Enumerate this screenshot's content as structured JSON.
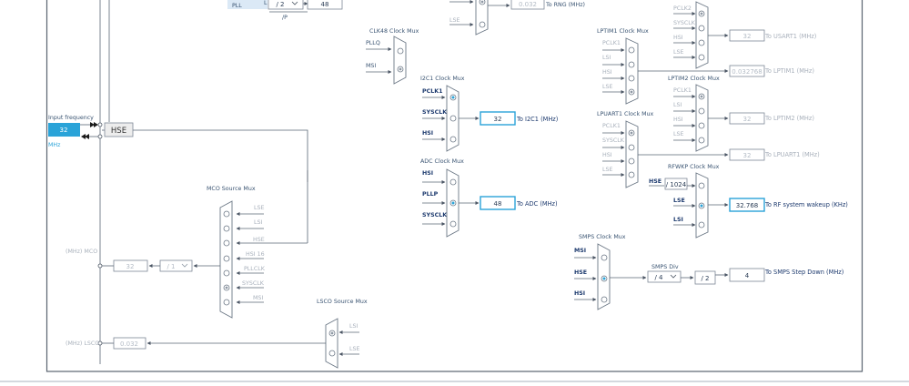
{
  "hse": {
    "label": "HSE",
    "input_label": "Input frequency",
    "input_value": "32",
    "input_unit": "MHz"
  },
  "pll": {
    "label": "PLL",
    "div_value": "/ 2",
    "out_value": "48",
    "p_label": "/P"
  },
  "rng": {
    "value": "0.032",
    "label": "To RNG (MHz)"
  },
  "clk48": {
    "title": "CLK48 Clock Mux",
    "inputs": [
      "PLLQ",
      "MSI"
    ]
  },
  "i2c1": {
    "title": "I2C1 Clock Mux",
    "inputs": [
      "PCLK1",
      "SYSCLK",
      "HSI"
    ],
    "value": "32",
    "label": "To I2C1 (MHz)"
  },
  "adc": {
    "title": "ADC Clock Mux",
    "inputs": [
      "HSI",
      "PLLP",
      "SYSCLK"
    ],
    "value": "48",
    "label": "To ADC (MHz)"
  },
  "usart1": {
    "inputs": [
      "PCLK2",
      "SYSCLK",
      "HSI",
      "LSE"
    ],
    "value": "32",
    "label": "To USART1 (MHz)"
  },
  "lptim1": {
    "title": "LPTIM1 Clock Mux",
    "inputs": [
      "PCLK1",
      "LSI",
      "HSI",
      "LSE"
    ],
    "value": "0.032768",
    "label": "To LPTIM1 (MHz)"
  },
  "lptim2": {
    "title": "LPTIM2 Clock Mux",
    "inputs": [
      "PCLK1",
      "LSI",
      "HSI",
      "LSE"
    ],
    "value": "32",
    "label": "To LPTIM2 (MHz)"
  },
  "lpuart1": {
    "title": "LPUART1 Clock Mux",
    "inputs": [
      "PCLK1",
      "SYSCLK",
      "HSI",
      "LSE"
    ],
    "value": "32",
    "label": "To LPUART1 (MHz)"
  },
  "rfwkp": {
    "title": "RFWKP Clock Mux",
    "hse_label": "HSE",
    "div_value": "/ 1024",
    "inputs": [
      "LSE",
      "LSI"
    ],
    "value": "32.768",
    "label": "To RF system wakeup (KHz)"
  },
  "smps": {
    "title": "SMPS Clock Mux",
    "inputs": [
      "MSI",
      "HSE",
      "HSI"
    ],
    "div_title": "SMPS Div",
    "div_value": "/ 4",
    "div2_value": "/ 2",
    "value": "4",
    "label": "To SMPS Step Down (MHz)"
  },
  "mco": {
    "title": "MCO Source Mux",
    "inputs": [
      "LSE",
      "LSI",
      "HSE",
      "HSI 16",
      "PLLCLK",
      "SYSCLK",
      "MSI"
    ],
    "label": "(MHz) MCO",
    "value": "32",
    "div_value": "/ 1"
  },
  "lsco": {
    "title": "LSCO Source Mux",
    "inputs": [
      "LSI",
      "LSE"
    ],
    "label": "(MHz) LSCO",
    "value": "0.032"
  }
}
